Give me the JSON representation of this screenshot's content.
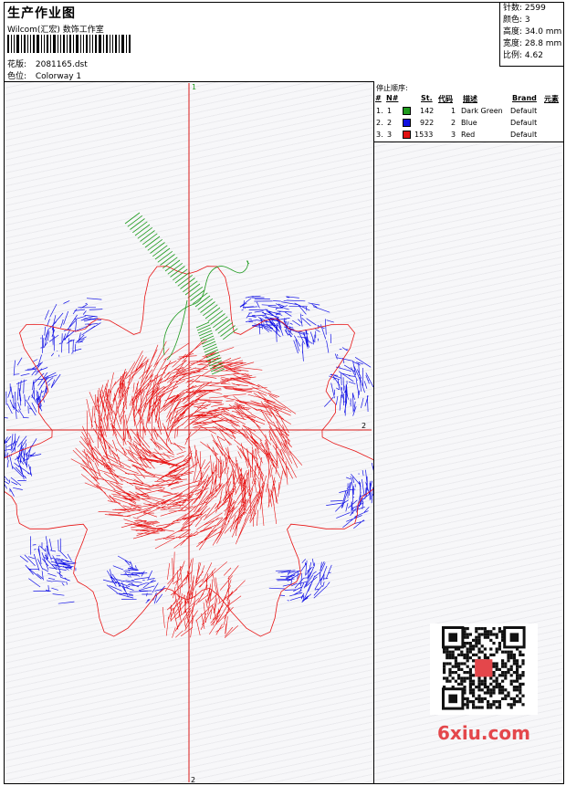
{
  "header": {
    "title": "生产作业图",
    "studio": "Wilcom(汇宏) 数饰工作室",
    "design_label": "花版:",
    "design_value": "2081165.dst",
    "color_label": "色位:",
    "color_value": "Colorway 1"
  },
  "stats": {
    "stitches": "针数: 2599",
    "colors": "颜色: 3",
    "height": "高度: 34.0 mm",
    "width": "宽度: 28.8 mm",
    "scale": "比例: 4.62"
  },
  "axes": {
    "top_label": "1",
    "bottom_label": "2",
    "right_label": "2"
  },
  "stop_sequence": {
    "title": "停止顺序:",
    "headers": [
      "#",
      "N#",
      "St.",
      "代码",
      "描述",
      "Brand",
      "元素"
    ],
    "rows": [
      {
        "idx": "1.",
        "n": "1",
        "color": "#1e9a1e",
        "st": "142",
        "code": "1",
        "desc": "Dark Green",
        "brand": "Default"
      },
      {
        "idx": "2.",
        "n": "2",
        "color": "#1010e0",
        "st": "922",
        "code": "2",
        "desc": "Blue",
        "brand": "Default"
      },
      {
        "idx": "3.",
        "n": "3",
        "color": "#e01010",
        "st": "1533",
        "code": "3",
        "desc": "Red",
        "brand": "Default"
      }
    ]
  },
  "watermark": {
    "text": "6xiu.com",
    "color": "#e4474b"
  },
  "colors": {
    "green": "#1e9a1e",
    "blue": "#1414e6",
    "red": "#e81414",
    "axis": "#d81818"
  }
}
